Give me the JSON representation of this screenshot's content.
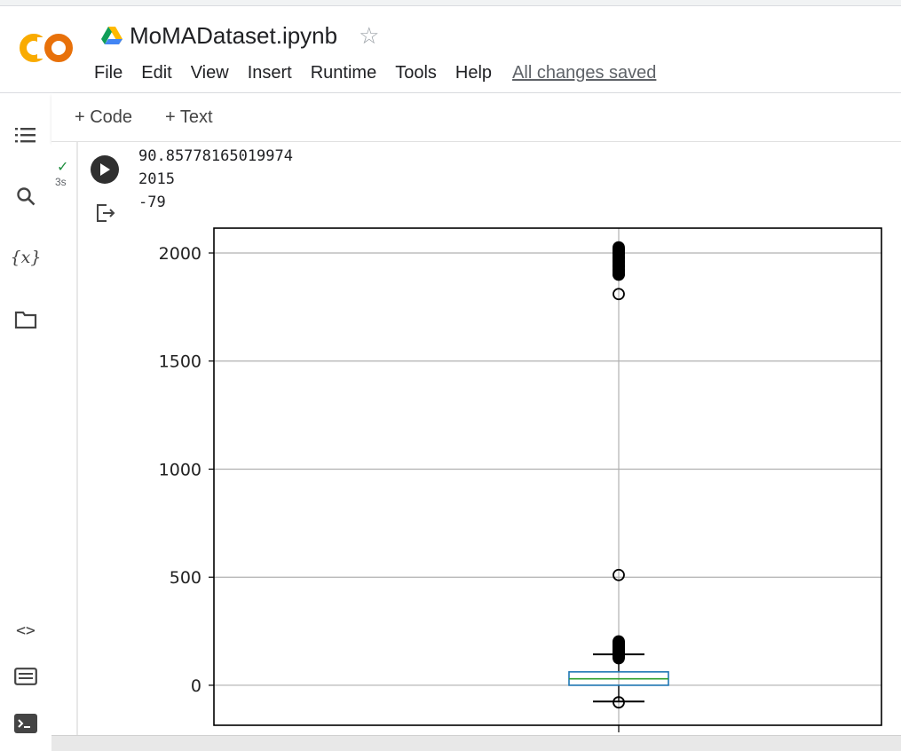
{
  "header": {
    "doc_title": "MoMADataset.ipynb",
    "menu": [
      "File",
      "Edit",
      "View",
      "Insert",
      "Runtime",
      "Tools",
      "Help"
    ],
    "save_status": "All changes saved",
    "logo": "colab-logo",
    "drive_icon": "google-drive-icon",
    "star_icon": "star-outline-icon"
  },
  "sidebar": {
    "icons": [
      "table-of-contents-icon",
      "search-icon",
      "variables-icon",
      "folder-icon",
      "code-snippets-icon",
      "command-palette-icon",
      "terminal-icon"
    ]
  },
  "toolbar": {
    "add_code": "+ Code",
    "add_text": "+ Text"
  },
  "cell": {
    "status": "success",
    "exec_time": "3s",
    "output_lines": [
      "90.85778165019974",
      "2015",
      "-79"
    ]
  },
  "chart_data": {
    "type": "box",
    "yticks": [
      0,
      500,
      1000,
      1500,
      2000
    ],
    "ylim": [
      -185,
      2115
    ],
    "grid": true,
    "box": {
      "q1": 0,
      "median": 30,
      "q3": 62,
      "whisker_low": -75,
      "whisker_high": 143,
      "outliers": [
        -79,
        130,
        140,
        150,
        160,
        170,
        180,
        190,
        200,
        510,
        1810,
        1900,
        1920,
        1940,
        1960,
        1980,
        2000,
        2015
      ]
    },
    "colors": {
      "box": "#1f77b4",
      "median": "#2ca02c",
      "whisker": "#000000",
      "grid": "#b0b0b0"
    }
  }
}
